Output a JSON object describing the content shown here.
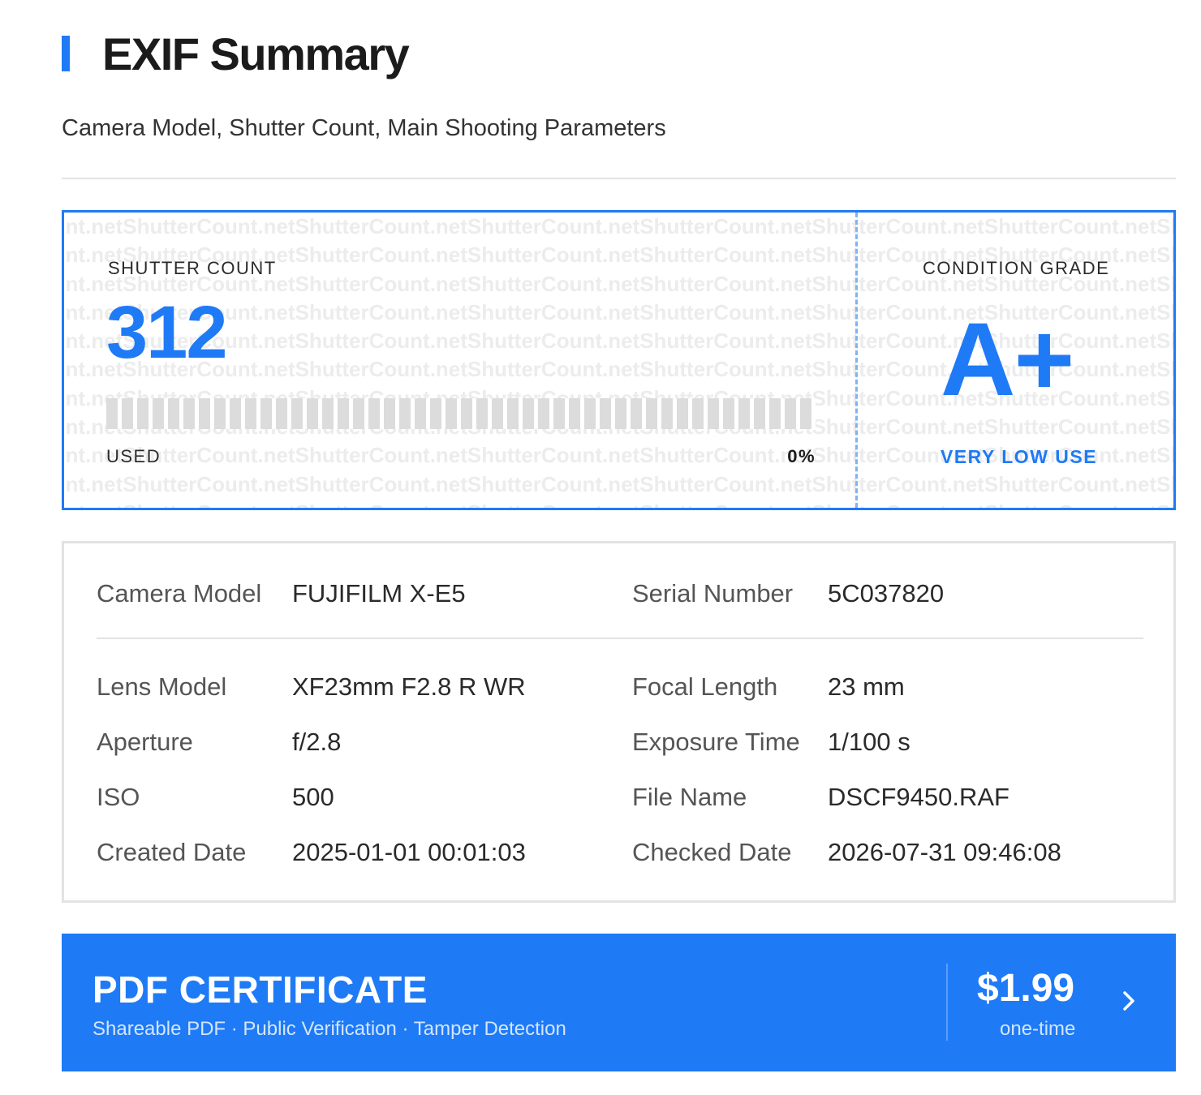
{
  "header": {
    "title": "EXIF Summary",
    "subtitle": "Camera Model, Shutter Count, Main Shooting Parameters"
  },
  "shutter_card": {
    "watermark_text": "ShutterCount.net",
    "shutter_count_label": "SHUTTER COUNT",
    "shutter_count_value": "312",
    "used_label": "USED",
    "used_percent_text": "0%",
    "used_fraction": 0.0,
    "condition_label": "CONDITION GRADE",
    "condition_value": "A+",
    "condition_desc": "VERY LOW USE"
  },
  "details": {
    "camera_model": {
      "label": "Camera Model",
      "value": "FUJIFILM X-E5"
    },
    "serial_number": {
      "label": "Serial Number",
      "value": "5C037820"
    },
    "lens_model": {
      "label": "Lens Model",
      "value": "XF23mm F2.8 R WR"
    },
    "focal_length": {
      "label": "Focal Length",
      "value": "23 mm"
    },
    "aperture": {
      "label": "Aperture",
      "value": "f/2.8"
    },
    "exposure_time": {
      "label": "Exposure Time",
      "value": "1/100 s"
    },
    "iso": {
      "label": "ISO",
      "value": "500"
    },
    "file_name": {
      "label": "File Name",
      "value": "DSCF9450.RAF"
    },
    "created_date": {
      "label": "Created Date",
      "value": "2025-01-01 00:01:03"
    },
    "checked_date": {
      "label": "Checked Date",
      "value": "2026-07-31 09:46:08"
    }
  },
  "cta": {
    "title": "PDF CERTIFICATE",
    "subtitle": "Shareable PDF · Public Verification · Tamper Detection",
    "price": "$1.99",
    "price_note": "one-time",
    "arrow_icon": "chevron-right-icon"
  },
  "colors": {
    "accent": "#1f7af6",
    "text_dark": "#1b1b1b",
    "border_gray": "#e3e3e3"
  }
}
